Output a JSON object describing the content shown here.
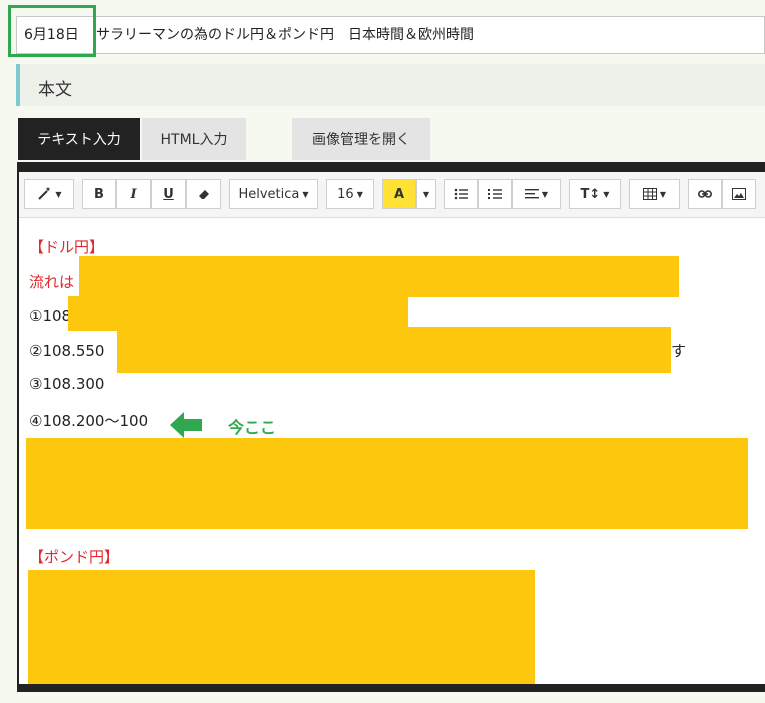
{
  "title": {
    "date": "6月18日",
    "text": "サラリーマンの為のドル円＆ポンド円　日本時間＆欧州時間"
  },
  "section": {
    "label": "本文"
  },
  "tabs": {
    "text_input": "テキスト入力",
    "html_input": "HTML入力",
    "image_manager": "画像管理を開く"
  },
  "toolbar": {
    "font_name": "Helvetica",
    "font_size": "16",
    "bold": "B",
    "italic": "I",
    "underline": "U",
    "highlight": "A",
    "text_size": "T↕"
  },
  "content": {
    "dollar_heading": "【ドル円】",
    "flow_line": "流れは",
    "item1": "①108",
    "item2": "②108.550",
    "item2_tail": "す",
    "item3": "③108.300",
    "item4": "④108.200〜100",
    "now_here": "今ここ",
    "pound_heading": "【ポンド円】"
  },
  "colors": {
    "accent_green": "#2fa84f",
    "redaction": "#fcc70d",
    "heading_red": "#e0282f"
  }
}
